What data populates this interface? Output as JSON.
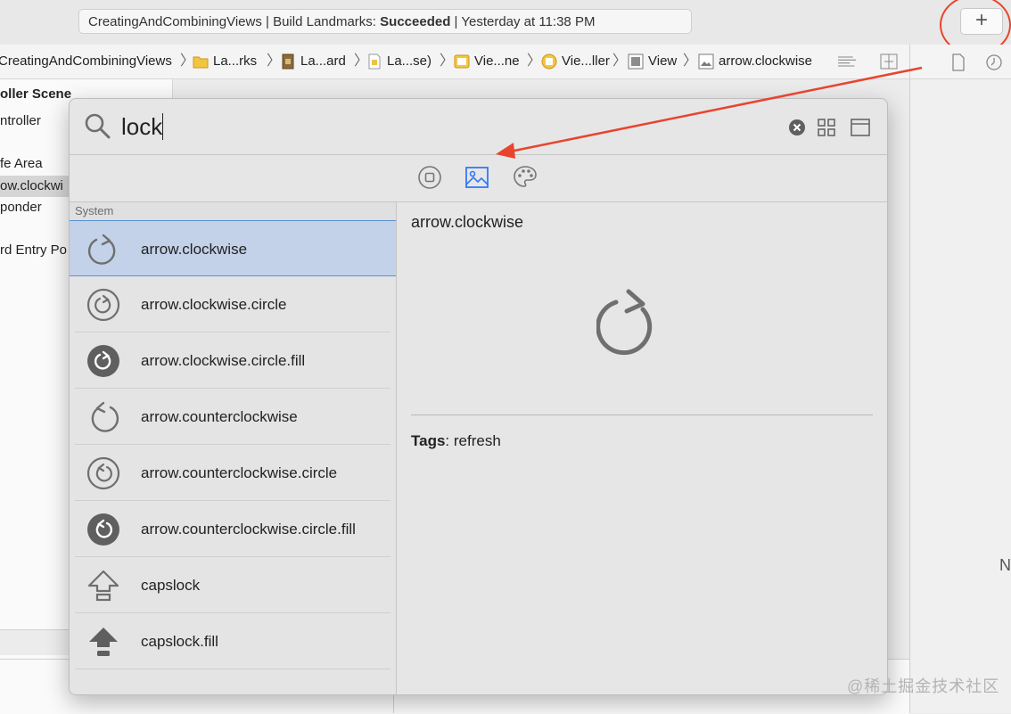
{
  "toolbar": {
    "status_project": "CreatingAndCombiningViews",
    "status_build_prefix": "Build Landmarks:",
    "status_build_result": "Succeeded",
    "status_time": "Yesterday at 11:38 PM",
    "add_button_label": "+"
  },
  "jumpbar": {
    "crumbs": [
      "CreatingAndCombiningViews",
      "La...rks",
      "La...ard",
      "La...se)",
      "Vie...ne",
      "Vie...ller",
      "View",
      "arrow.clockwise"
    ]
  },
  "outline": {
    "items": [
      "oller Scene",
      "ntroller",
      "fe Area",
      "ow.clockwi",
      "ponder",
      "rd Entry Po"
    ]
  },
  "library": {
    "search_value": "lock",
    "section_header": "System",
    "symbols": [
      {
        "name": "arrow.clockwise",
        "icon": "arrow-clockwise-icon"
      },
      {
        "name": "arrow.clockwise.circle",
        "icon": "arrow-clockwise-circle-icon"
      },
      {
        "name": "arrow.clockwise.circle.fill",
        "icon": "arrow-clockwise-circle-fill-icon"
      },
      {
        "name": "arrow.counterclockwise",
        "icon": "arrow-counterclockwise-icon"
      },
      {
        "name": "arrow.counterclockwise.circle",
        "icon": "arrow-counterclockwise-circle-icon"
      },
      {
        "name": "arrow.counterclockwise.circle.fill",
        "icon": "arrow-counterclockwise-circle-fill-icon"
      },
      {
        "name": "capslock",
        "icon": "capslock-icon"
      },
      {
        "name": "capslock.fill",
        "icon": "capslock-fill-icon"
      }
    ],
    "selected_index": 0,
    "detail": {
      "title": "arrow.clockwise",
      "tags_label": "Tags",
      "tags_value": "refresh"
    }
  },
  "inspector": {
    "partial_label": "N"
  },
  "watermark": "@稀土掘金技术社区",
  "colors": {
    "accent": "#3478f6",
    "selection": "#c3d1e9",
    "annotation_red": "#e8442e"
  }
}
